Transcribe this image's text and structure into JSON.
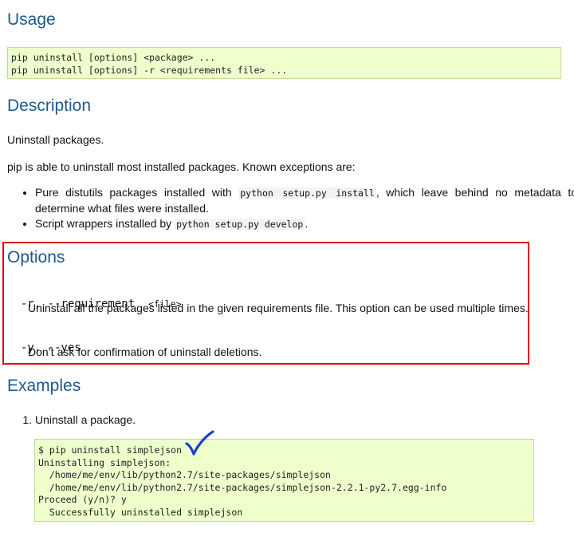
{
  "usage": {
    "heading": "Usage",
    "code": "pip uninstall [options] <package> ...\npip uninstall [options] -r <requirements file> ..."
  },
  "description": {
    "heading": "Description",
    "intro": "Uninstall packages.",
    "exceptions_intro": "pip is able to uninstall most installed packages. Known exceptions are:",
    "bullets": [
      {
        "before": "Pure distutils packages installed with ",
        "code": "python setup.py install",
        "after": ", which leave behind no metadata to determine what files were installed."
      },
      {
        "before": "Script wrappers installed by ",
        "code": "python setup.py develop",
        "after": "."
      }
    ]
  },
  "options": {
    "heading": "Options",
    "items": [
      {
        "name": "-r, --requirement",
        "arg": "<file>",
        "description": "Uninstall all the packages listed in the given requirements file. This option can be used multiple times."
      },
      {
        "name": "-y, --yes",
        "arg": "",
        "description": "Don’t ask for confirmation of uninstall deletions."
      }
    ]
  },
  "examples": {
    "heading": "Examples",
    "items": [
      {
        "label": "Uninstall a package.",
        "code": "$ pip uninstall simplejson\nUninstalling simplejson:\n  /home/me/env/lib/python2.7/site-packages/simplejson\n  /home/me/env/lib/python2.7/site-packages/simplejson-2.2.1-py2.7.egg-info\nProceed (y/n)? y\n  Successfully uninstalled simplejson"
      }
    ]
  },
  "annotations": {
    "highlight_color": "#e01010",
    "checkmark_color": "#1a3fd6"
  }
}
